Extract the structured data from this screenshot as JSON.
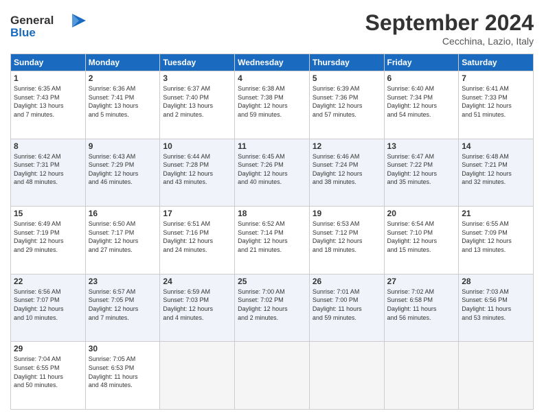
{
  "logo": {
    "line1": "General",
    "line2": "Blue"
  },
  "title": "September 2024",
  "location": "Cecchina, Lazio, Italy",
  "headers": [
    "Sunday",
    "Monday",
    "Tuesday",
    "Wednesday",
    "Thursday",
    "Friday",
    "Saturday"
  ],
  "weeks": [
    [
      {
        "day": "1",
        "info": "Sunrise: 6:35 AM\nSunset: 7:43 PM\nDaylight: 13 hours\nand 7 minutes."
      },
      {
        "day": "2",
        "info": "Sunrise: 6:36 AM\nSunset: 7:41 PM\nDaylight: 13 hours\nand 5 minutes."
      },
      {
        "day": "3",
        "info": "Sunrise: 6:37 AM\nSunset: 7:40 PM\nDaylight: 13 hours\nand 2 minutes."
      },
      {
        "day": "4",
        "info": "Sunrise: 6:38 AM\nSunset: 7:38 PM\nDaylight: 12 hours\nand 59 minutes."
      },
      {
        "day": "5",
        "info": "Sunrise: 6:39 AM\nSunset: 7:36 PM\nDaylight: 12 hours\nand 57 minutes."
      },
      {
        "day": "6",
        "info": "Sunrise: 6:40 AM\nSunset: 7:34 PM\nDaylight: 12 hours\nand 54 minutes."
      },
      {
        "day": "7",
        "info": "Sunrise: 6:41 AM\nSunset: 7:33 PM\nDaylight: 12 hours\nand 51 minutes."
      }
    ],
    [
      {
        "day": "8",
        "info": "Sunrise: 6:42 AM\nSunset: 7:31 PM\nDaylight: 12 hours\nand 48 minutes."
      },
      {
        "day": "9",
        "info": "Sunrise: 6:43 AM\nSunset: 7:29 PM\nDaylight: 12 hours\nand 46 minutes."
      },
      {
        "day": "10",
        "info": "Sunrise: 6:44 AM\nSunset: 7:28 PM\nDaylight: 12 hours\nand 43 minutes."
      },
      {
        "day": "11",
        "info": "Sunrise: 6:45 AM\nSunset: 7:26 PM\nDaylight: 12 hours\nand 40 minutes."
      },
      {
        "day": "12",
        "info": "Sunrise: 6:46 AM\nSunset: 7:24 PM\nDaylight: 12 hours\nand 38 minutes."
      },
      {
        "day": "13",
        "info": "Sunrise: 6:47 AM\nSunset: 7:22 PM\nDaylight: 12 hours\nand 35 minutes."
      },
      {
        "day": "14",
        "info": "Sunrise: 6:48 AM\nSunset: 7:21 PM\nDaylight: 12 hours\nand 32 minutes."
      }
    ],
    [
      {
        "day": "15",
        "info": "Sunrise: 6:49 AM\nSunset: 7:19 PM\nDaylight: 12 hours\nand 29 minutes."
      },
      {
        "day": "16",
        "info": "Sunrise: 6:50 AM\nSunset: 7:17 PM\nDaylight: 12 hours\nand 27 minutes."
      },
      {
        "day": "17",
        "info": "Sunrise: 6:51 AM\nSunset: 7:16 PM\nDaylight: 12 hours\nand 24 minutes."
      },
      {
        "day": "18",
        "info": "Sunrise: 6:52 AM\nSunset: 7:14 PM\nDaylight: 12 hours\nand 21 minutes."
      },
      {
        "day": "19",
        "info": "Sunrise: 6:53 AM\nSunset: 7:12 PM\nDaylight: 12 hours\nand 18 minutes."
      },
      {
        "day": "20",
        "info": "Sunrise: 6:54 AM\nSunset: 7:10 PM\nDaylight: 12 hours\nand 15 minutes."
      },
      {
        "day": "21",
        "info": "Sunrise: 6:55 AM\nSunset: 7:09 PM\nDaylight: 12 hours\nand 13 minutes."
      }
    ],
    [
      {
        "day": "22",
        "info": "Sunrise: 6:56 AM\nSunset: 7:07 PM\nDaylight: 12 hours\nand 10 minutes."
      },
      {
        "day": "23",
        "info": "Sunrise: 6:57 AM\nSunset: 7:05 PM\nDaylight: 12 hours\nand 7 minutes."
      },
      {
        "day": "24",
        "info": "Sunrise: 6:59 AM\nSunset: 7:03 PM\nDaylight: 12 hours\nand 4 minutes."
      },
      {
        "day": "25",
        "info": "Sunrise: 7:00 AM\nSunset: 7:02 PM\nDaylight: 12 hours\nand 2 minutes."
      },
      {
        "day": "26",
        "info": "Sunrise: 7:01 AM\nSunset: 7:00 PM\nDaylight: 11 hours\nand 59 minutes."
      },
      {
        "day": "27",
        "info": "Sunrise: 7:02 AM\nSunset: 6:58 PM\nDaylight: 11 hours\nand 56 minutes."
      },
      {
        "day": "28",
        "info": "Sunrise: 7:03 AM\nSunset: 6:56 PM\nDaylight: 11 hours\nand 53 minutes."
      }
    ],
    [
      {
        "day": "29",
        "info": "Sunrise: 7:04 AM\nSunset: 6:55 PM\nDaylight: 11 hours\nand 50 minutes."
      },
      {
        "day": "30",
        "info": "Sunrise: 7:05 AM\nSunset: 6:53 PM\nDaylight: 11 hours\nand 48 minutes."
      },
      {
        "day": "",
        "info": ""
      },
      {
        "day": "",
        "info": ""
      },
      {
        "day": "",
        "info": ""
      },
      {
        "day": "",
        "info": ""
      },
      {
        "day": "",
        "info": ""
      }
    ]
  ]
}
